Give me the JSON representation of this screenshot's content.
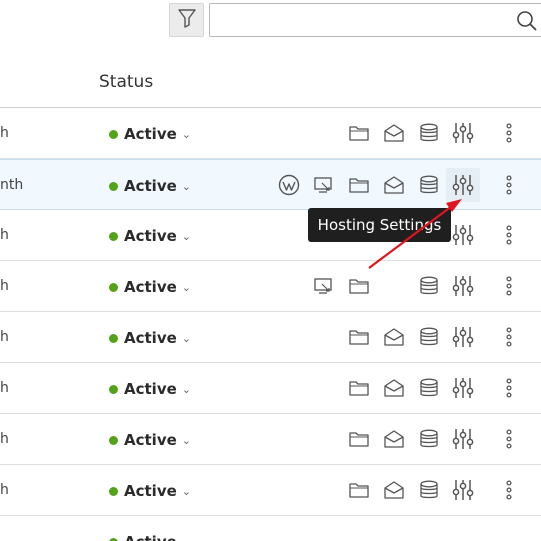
{
  "toolbar": {
    "filter_icon": "funnel-icon",
    "search_value": "",
    "search_icon": "magnifier-icon"
  },
  "table": {
    "status_header": "Status",
    "rows": [
      {
        "left": "h",
        "status": "Active",
        "icons": [
          "folder",
          "mail",
          "db",
          "sliders",
          "more"
        ]
      },
      {
        "left": "nth",
        "status": "Active",
        "icons": [
          "wp",
          "monitor",
          "folder",
          "mail",
          "db",
          "sliders",
          "more"
        ],
        "highlight": true
      },
      {
        "left": "h",
        "status": "Active",
        "icons": [
          "sliders",
          "more"
        ]
      },
      {
        "left": "h",
        "status": "Active",
        "icons": [
          "monitor",
          "folder",
          "db",
          "sliders",
          "more"
        ]
      },
      {
        "left": "h",
        "status": "Active",
        "icons": [
          "folder",
          "mail",
          "db",
          "sliders",
          "more"
        ]
      },
      {
        "left": "h",
        "status": "Active",
        "icons": [
          "folder",
          "mail",
          "db",
          "sliders",
          "more"
        ]
      },
      {
        "left": "h",
        "status": "Active",
        "icons": [
          "folder",
          "mail",
          "db",
          "sliders",
          "more"
        ]
      },
      {
        "left": "h",
        "status": "Active",
        "icons": [
          "folder",
          "mail",
          "db",
          "sliders",
          "more"
        ]
      },
      {
        "left": "",
        "status": "Active",
        "icons": []
      }
    ]
  },
  "tooltip": {
    "text": "Hosting Settings"
  },
  "colors": {
    "active_dot": "#53a31a",
    "arrow": "#e0141e",
    "highlight_row": "#f1f8fe"
  }
}
